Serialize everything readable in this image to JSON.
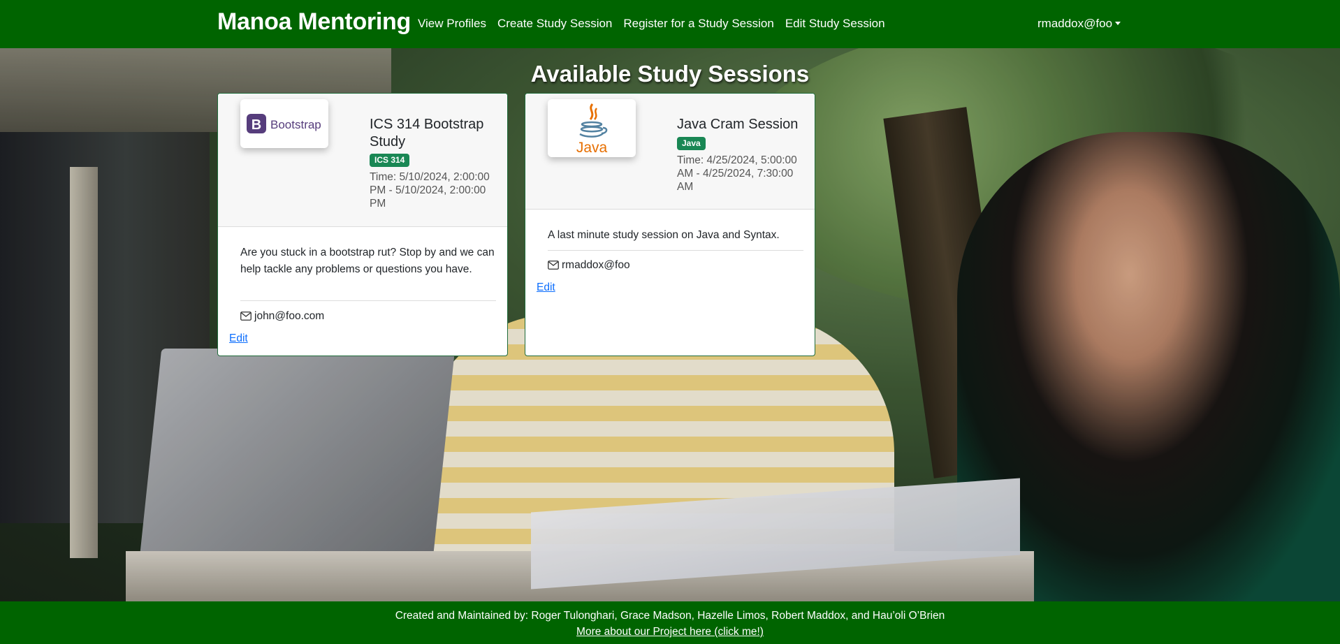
{
  "navbar": {
    "brand": "Manoa Mentoring",
    "links": [
      "View Profiles",
      "Create Study Session",
      "Register for a Study Session",
      "Edit Study Session"
    ],
    "user": "rmaddox@foo"
  },
  "page": {
    "heading": "Available Study Sessions"
  },
  "sessions": [
    {
      "logo_text": "Bootstrap",
      "logo_letter": "B",
      "title": "ICS 314 Bootstrap Study",
      "badge": "ICS 314",
      "time": "Time: 5/10/2024, 2:00:00 PM - 5/10/2024, 2:00:00 PM",
      "description": "Are you stuck in a bootstrap rut? Stop by and we can help tackle any problems or questions you have.",
      "email": "john@foo.com",
      "edit_label": "Edit"
    },
    {
      "logo_text": "Java",
      "title": "Java Cram Session",
      "badge": "Java",
      "time": "Time: 4/25/2024, 5:00:00 AM - 4/25/2024, 7:30:00 AM",
      "description": "A last minute study session on Java and Syntax.",
      "email": "rmaddox@foo",
      "edit_label": "Edit"
    }
  ],
  "footer": {
    "credits": "Created and Maintained by: Roger Tulonghari, Grace Madson, Hazelle Limos, Robert Maddox, and Hau’oli O’Brien",
    "link_text": "More about our Project here (click me!)"
  },
  "colors": {
    "nav_green": "#006400",
    "badge_green": "#198754",
    "link_blue": "#0d6efd",
    "bootstrap_purple": "#563d7c",
    "java_orange": "#e76f00"
  }
}
